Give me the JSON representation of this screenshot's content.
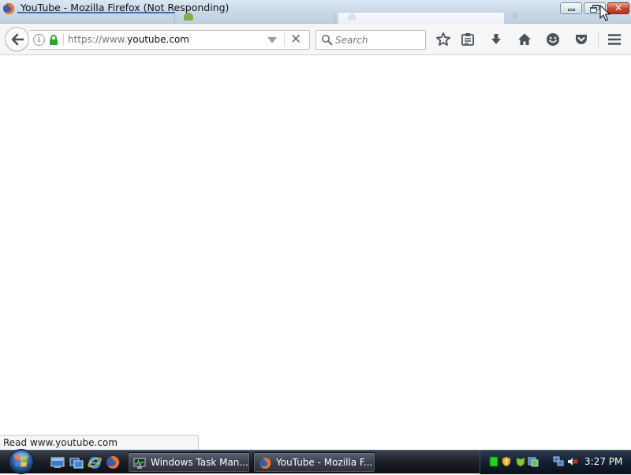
{
  "window": {
    "title": "YouTube - Mozilla Firefox (Not Responding)",
    "app_icon": "firefox-icon",
    "caption_buttons": [
      "minimize",
      "restore",
      "close"
    ]
  },
  "navbar": {
    "url_prefix": "https://www.",
    "url_host": "youtube.com",
    "search_placeholder": "Search",
    "icons": [
      "back-arrow-icon",
      "info-icon",
      "lock-icon",
      "dropmarker-icon",
      "stop-icon",
      "search-icon",
      "bookmark-star-icon",
      "reading-list-icon",
      "downloads-icon",
      "home-icon",
      "hello-icon",
      "pocket-icon",
      "menu-icon"
    ]
  },
  "status_bar": {
    "text": "Read www.youtube.com"
  },
  "taskbar": {
    "quick_launch": [
      "show-desktop-icon",
      "switch-windows-icon",
      "internet-explorer-icon",
      "firefox-icon"
    ],
    "tasks": [
      {
        "label": "Windows Task Man...",
        "icon": "task-manager-icon"
      },
      {
        "label": "YouTube - Mozilla F...",
        "icon": "firefox-icon"
      }
    ],
    "tray_icons": [
      "green-status-icon",
      "security-shield-icon",
      "defender-icon",
      "update-icon",
      "network-icon",
      "volume-muted-icon"
    ],
    "clock": "3:27 PM"
  },
  "colors": {
    "titlebar": "#c9d8e8",
    "close_button": "#c74b32",
    "taskbar": "#1c2027",
    "navbar": "#f5f6f7"
  }
}
